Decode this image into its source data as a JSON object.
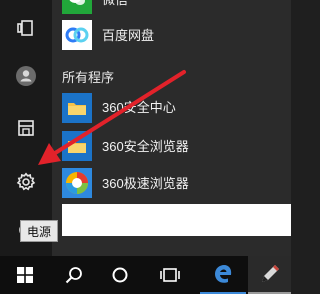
{
  "menu": {
    "section_all_programs": "所有程序",
    "top_partial_label": "微信",
    "apps": [
      {
        "label": "百度网盘",
        "icon": "baidu-netdisk-icon"
      },
      {
        "label": "360安全中心",
        "icon": "folder-icon"
      },
      {
        "label": "360安全浏览器",
        "icon": "360-safe-browser-icon"
      },
      {
        "label": "360极速浏览器",
        "icon": "360-speed-browser-icon"
      }
    ]
  },
  "rail": {
    "tooltip": "电源"
  },
  "taskbar": {
    "items": [
      "windows-start-icon",
      "search-icon",
      "cortana-icon",
      "task-view-icon",
      "edge-icon",
      "pen-app-icon"
    ]
  },
  "colors": {
    "annotation_arrow": "#e2222a",
    "accent": "#3c89d8"
  }
}
